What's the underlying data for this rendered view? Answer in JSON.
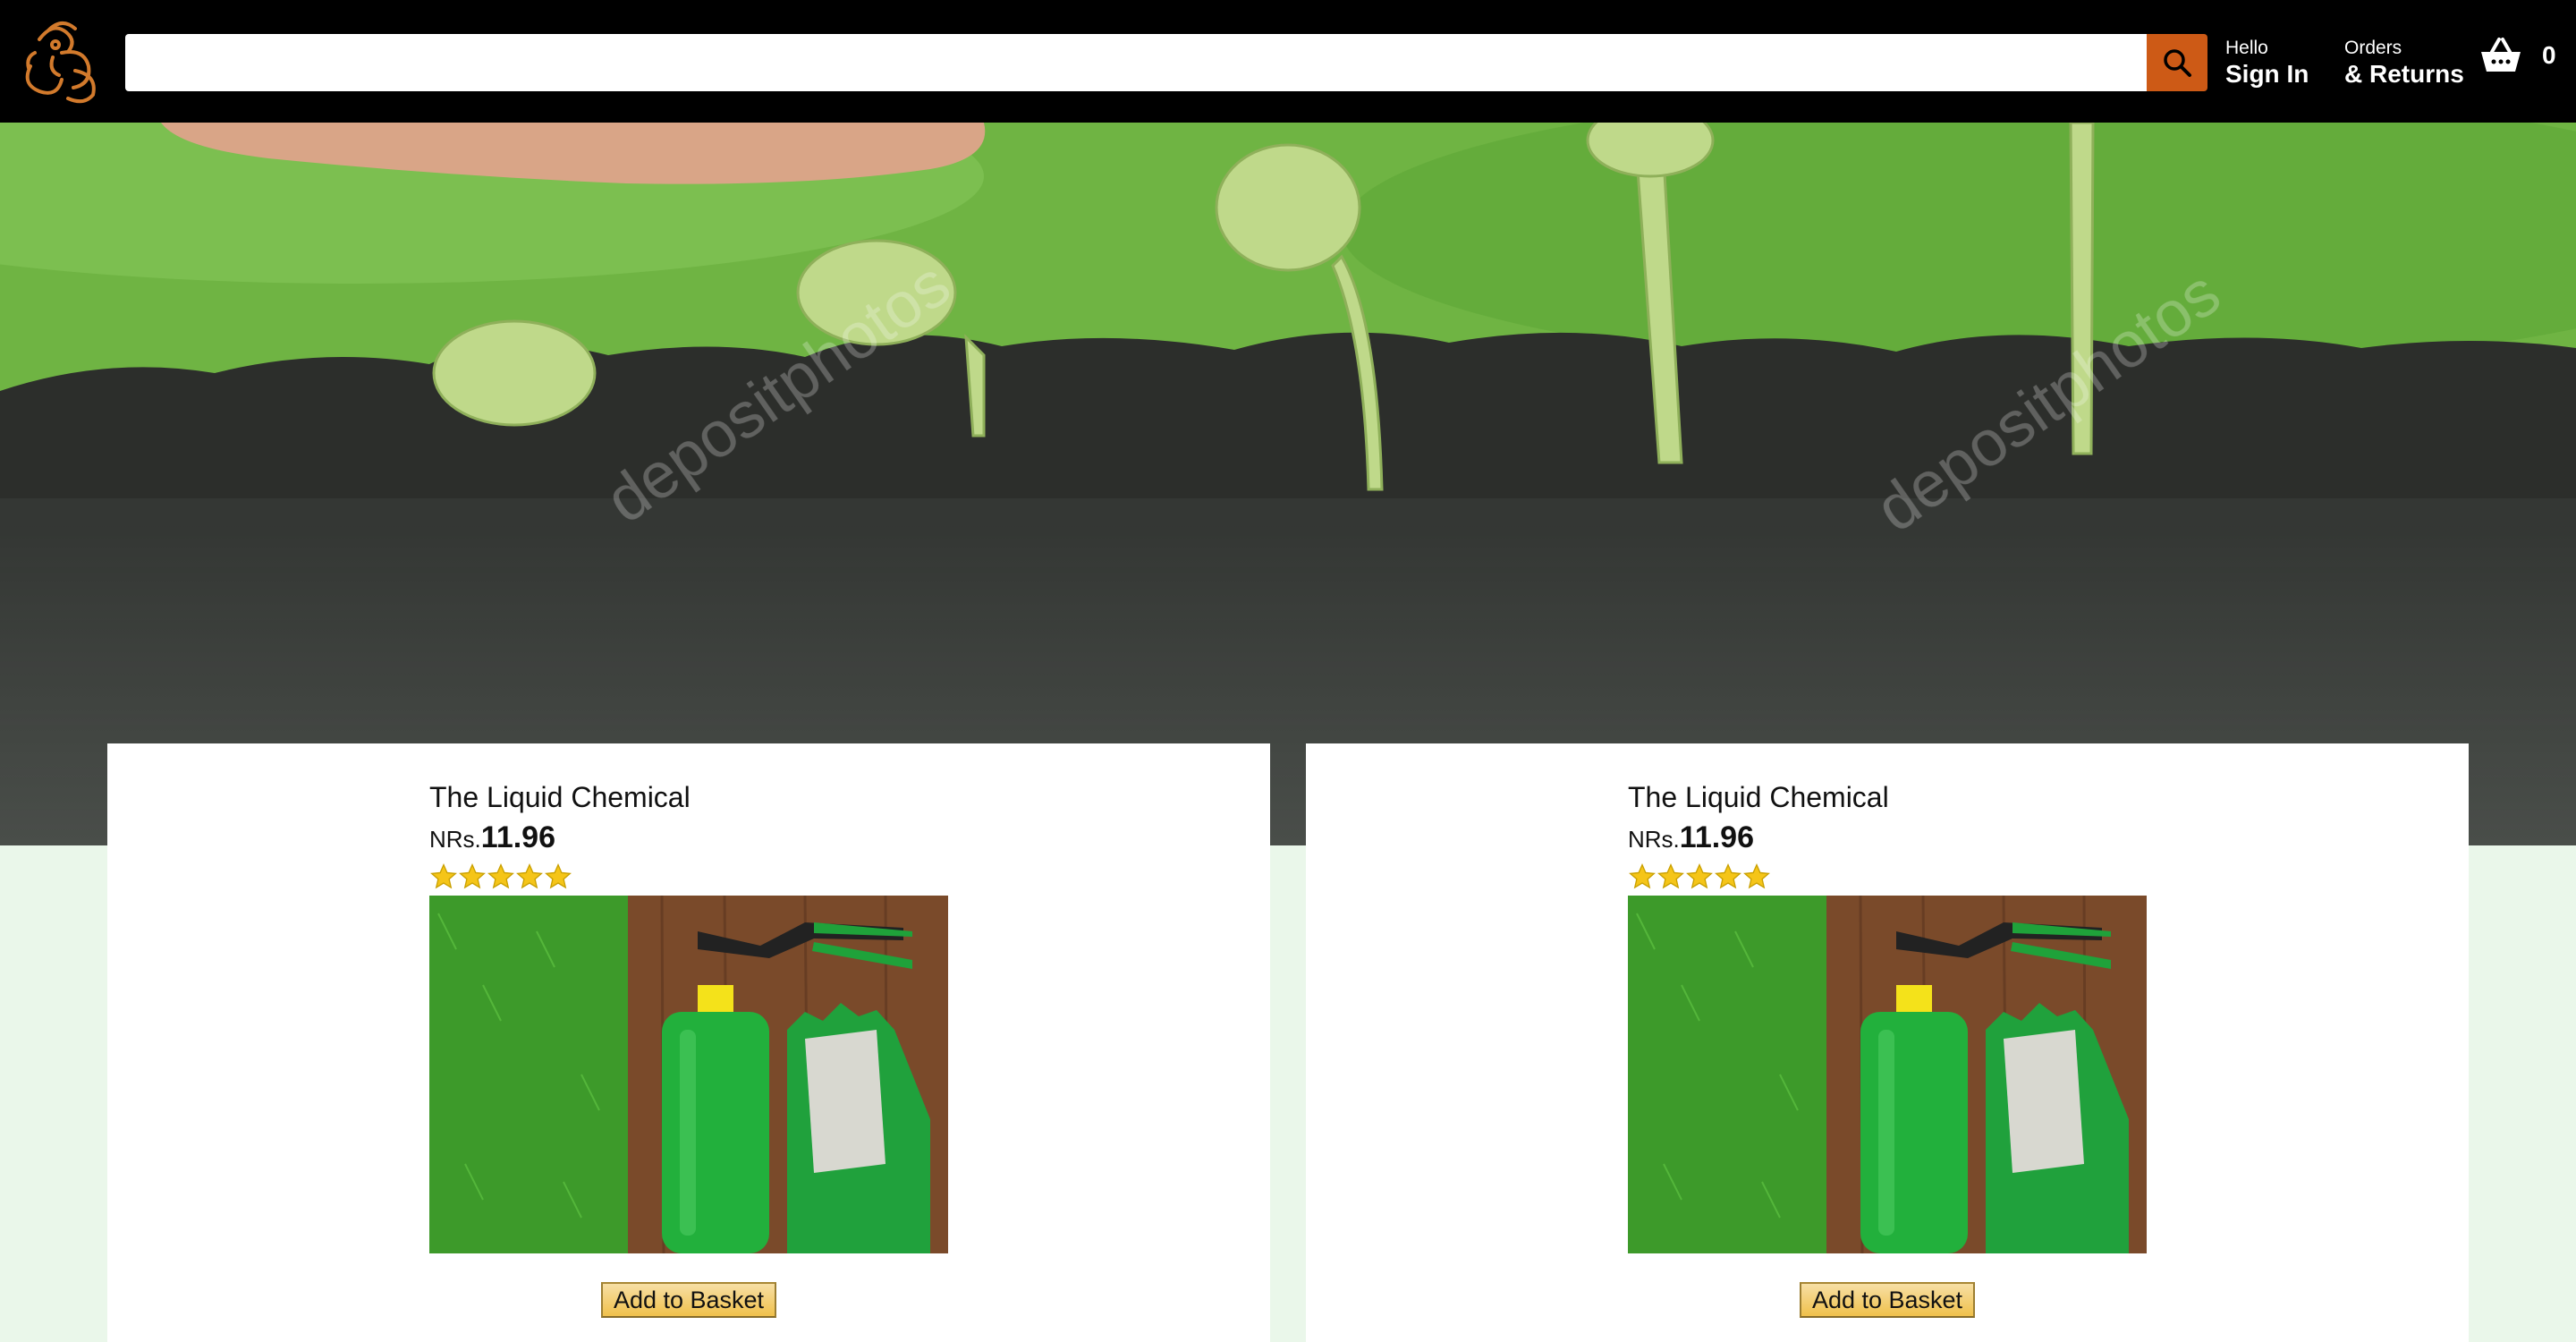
{
  "header": {
    "search": {
      "value": "",
      "placeholder": ""
    },
    "sign_in": {
      "line1": "Hello",
      "line2": "Sign In"
    },
    "orders": {
      "line1": "Orders",
      "line2": "& Returns"
    },
    "basket": {
      "count": "0"
    }
  },
  "hero": {
    "watermark": "depositphotos"
  },
  "products": [
    {
      "title": "The Liquid Chemical",
      "currency": "NRs.",
      "price": "11.96",
      "rating": 5,
      "image": "green-bottle-pruner-gloves-on-grass-and-wood",
      "button": "Add to Basket"
    },
    {
      "title": "The Liquid Chemical",
      "currency": "NRs.",
      "price": "11.96",
      "rating": 5,
      "image": "green-bottle-pruner-gloves-on-grass-and-wood",
      "button": "Add to Basket"
    }
  ],
  "colors": {
    "header_bg": "#000000",
    "search_button": "#cd5a16",
    "page_bg": "#eaf7ea",
    "star": "#f5c518"
  },
  "icons": [
    "ganesha-logo-icon",
    "search-icon",
    "basket-icon",
    "star-icon"
  ]
}
